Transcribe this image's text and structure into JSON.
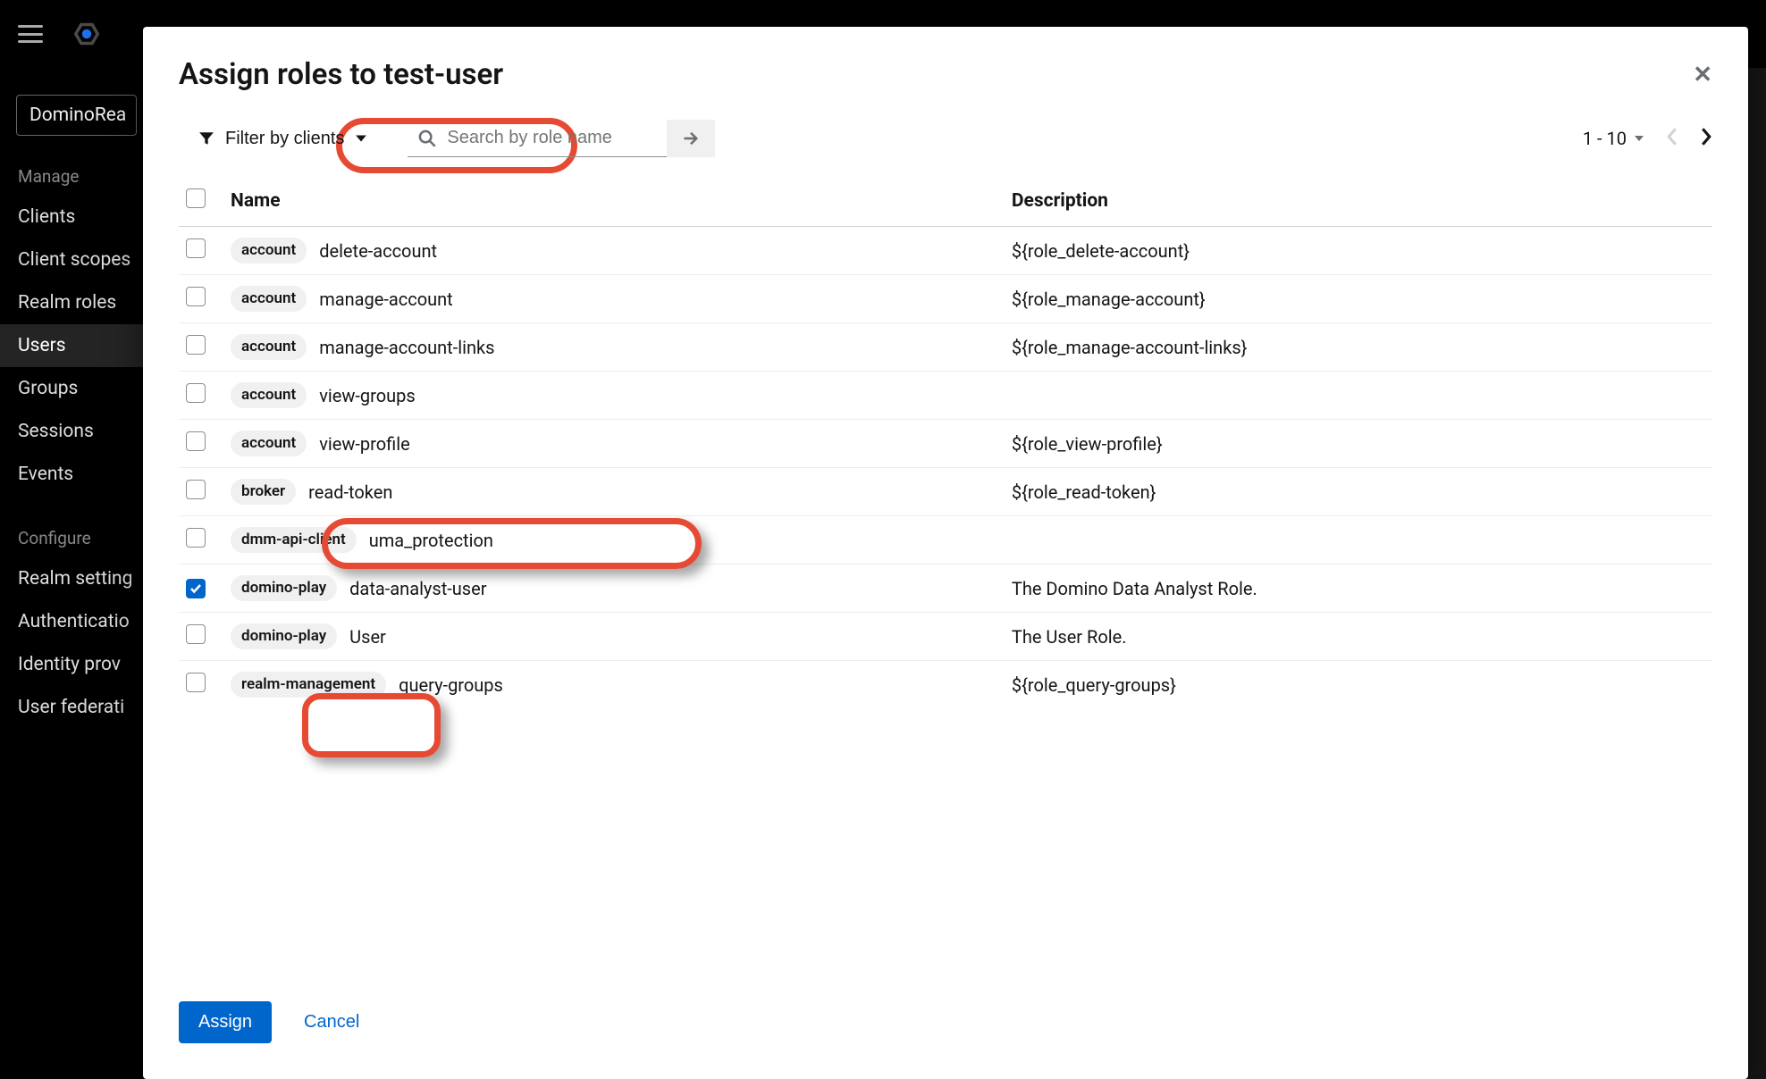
{
  "sidebar": {
    "realm": "DominoRea",
    "manage_label": "Manage",
    "configure_label": "Configure",
    "items_manage": [
      "Clients",
      "Client scopes",
      "Realm roles",
      "Users",
      "Groups",
      "Sessions",
      "Events"
    ],
    "items_configure": [
      "Realm setting",
      "Authenticatio",
      "Identity prov",
      "User federati"
    ],
    "active": "Users"
  },
  "modal": {
    "title": "Assign roles to test-user",
    "filter_label": "Filter by clients",
    "search_placeholder": "Search by role name",
    "pager_range": "1 - 10",
    "columns": {
      "name": "Name",
      "description": "Description"
    },
    "assign_label": "Assign",
    "cancel_label": "Cancel"
  },
  "roles": [
    {
      "client": "account",
      "name": "delete-account",
      "description": "${role_delete-account}",
      "checked": false
    },
    {
      "client": "account",
      "name": "manage-account",
      "description": "${role_manage-account}",
      "checked": false
    },
    {
      "client": "account",
      "name": "manage-account-links",
      "description": "${role_manage-account-links}",
      "checked": false
    },
    {
      "client": "account",
      "name": "view-groups",
      "description": "",
      "checked": false
    },
    {
      "client": "account",
      "name": "view-profile",
      "description": "${role_view-profile}",
      "checked": false
    },
    {
      "client": "broker",
      "name": "read-token",
      "description": "${role_read-token}",
      "checked": false
    },
    {
      "client": "dmm-api-client",
      "name": "uma_protection",
      "description": "",
      "checked": false
    },
    {
      "client": "domino-play",
      "name": "data-analyst-user",
      "description": "The Domino Data Analyst Role.",
      "checked": true
    },
    {
      "client": "domino-play",
      "name": "User",
      "description": "The User Role.",
      "checked": false
    },
    {
      "client": "realm-management",
      "name": "query-groups",
      "description": "${role_query-groups}",
      "checked": false
    }
  ]
}
